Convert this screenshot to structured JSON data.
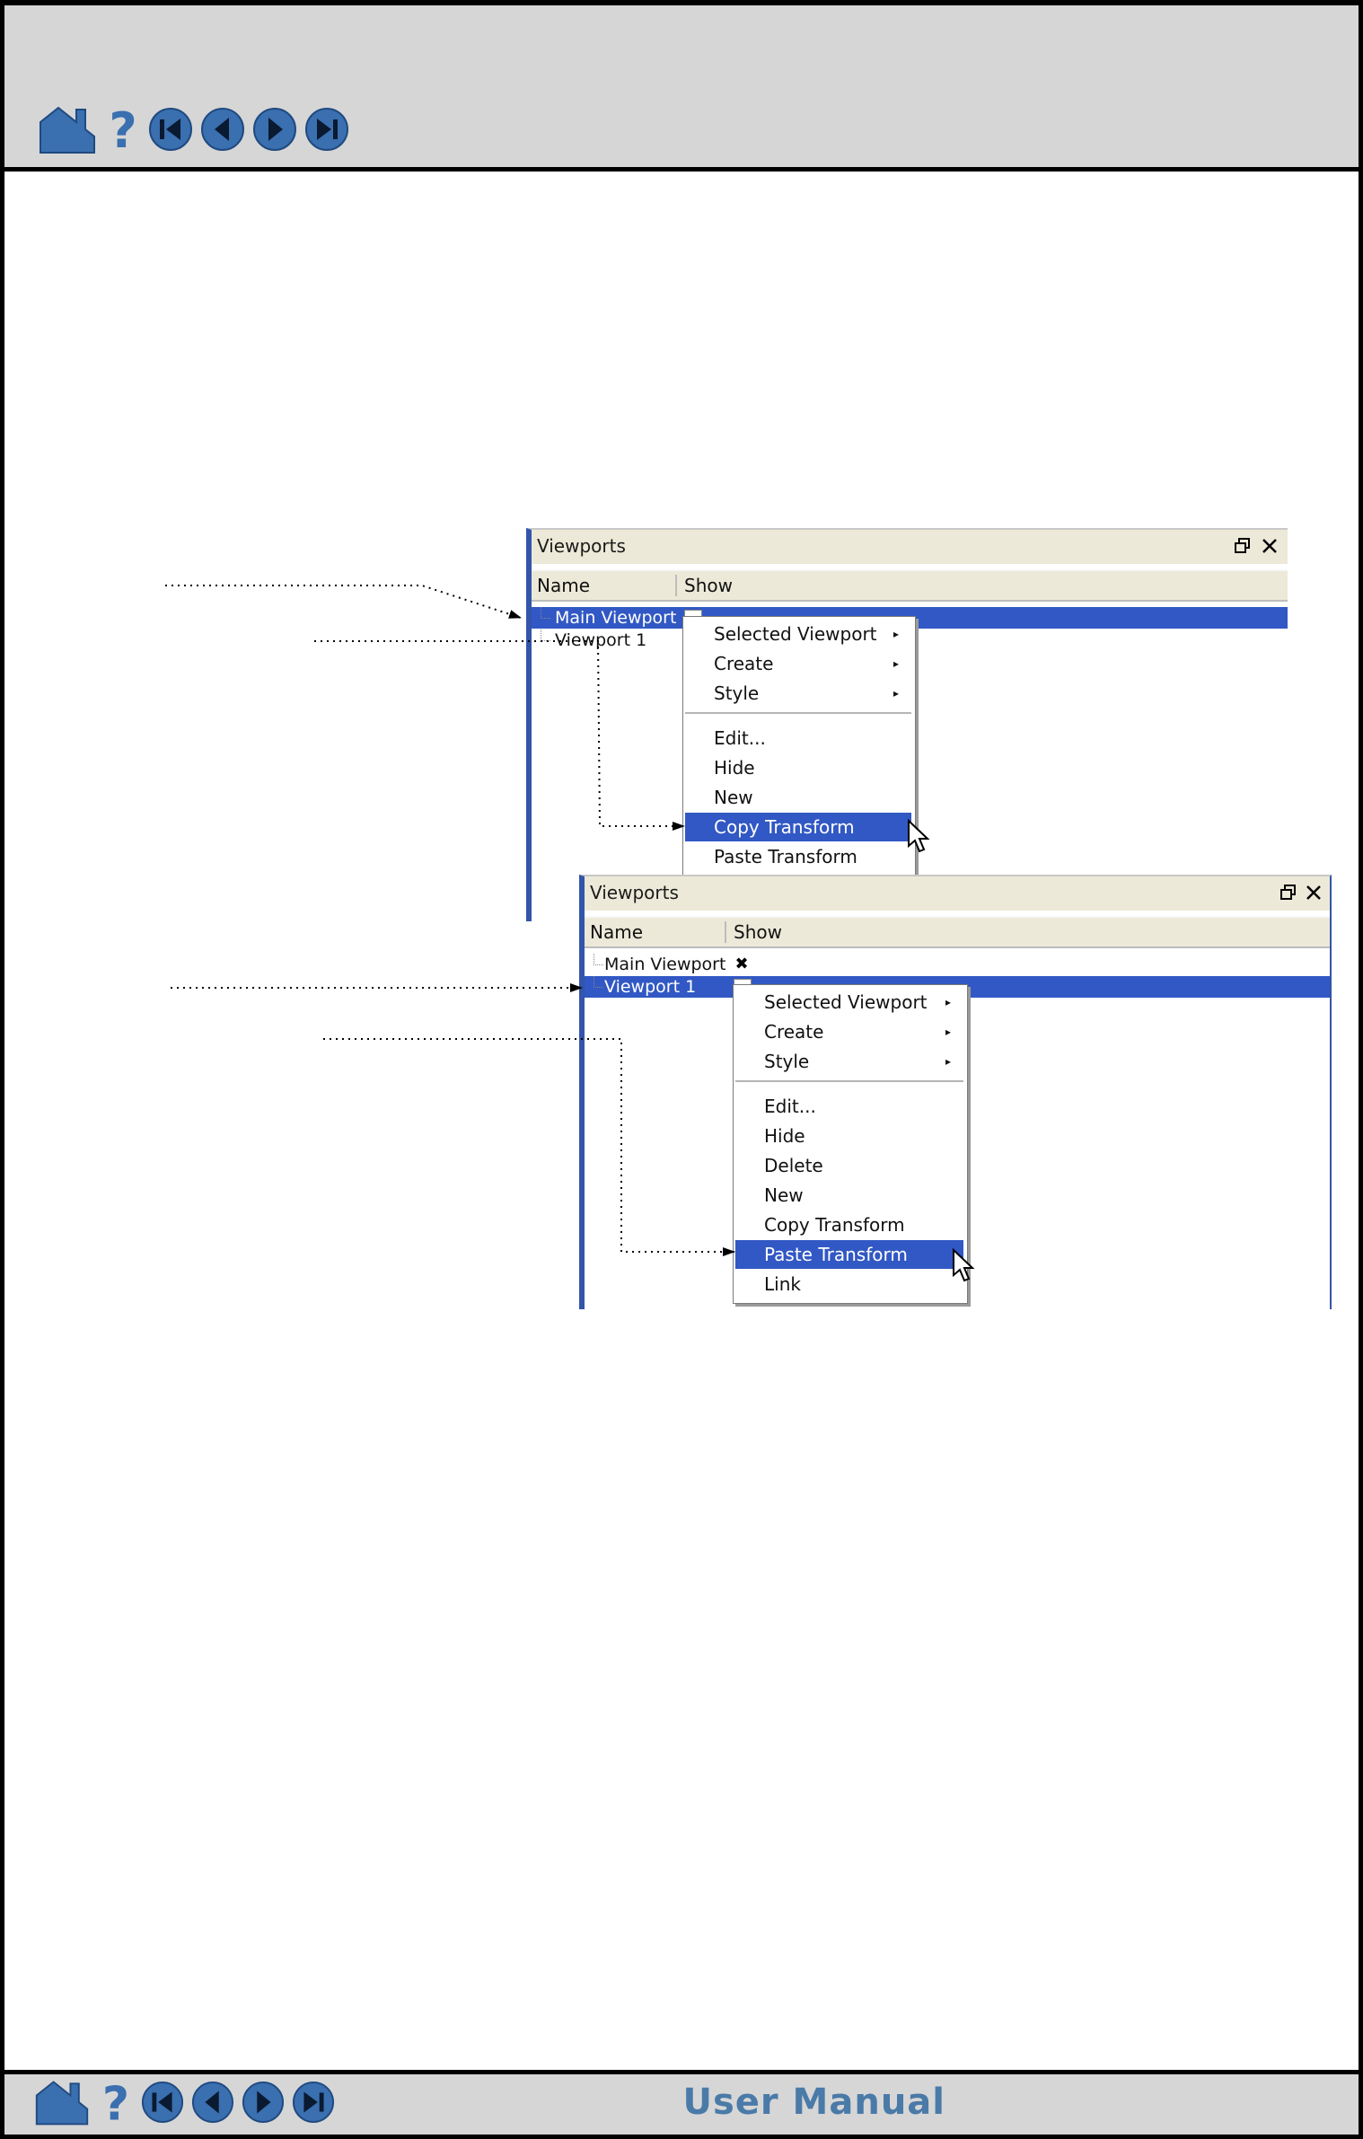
{
  "header": {
    "icons": [
      "home-icon",
      "help-icon",
      "first-page-icon",
      "previous-page-icon",
      "next-page-icon",
      "last-page-icon"
    ]
  },
  "footer": {
    "title": "User Manual"
  },
  "colors": {
    "accent": "#3158c4",
    "icon_blue": "#3a6fb0",
    "bar_gray": "#d6d6d6"
  },
  "panel_top": {
    "title": "Viewports",
    "columns": {
      "name": "Name",
      "show": "Show"
    },
    "rows": [
      {
        "label": "Main Viewport",
        "selected": true
      },
      {
        "label": "Viewport 1",
        "selected": false
      }
    ],
    "menu": {
      "group1": [
        {
          "label": "Selected Viewport",
          "submenu": true
        },
        {
          "label": "Create",
          "submenu": true
        },
        {
          "label": "Style",
          "submenu": true
        }
      ],
      "group2": [
        {
          "label": "Edit..."
        },
        {
          "label": "Hide"
        },
        {
          "label": "New"
        },
        {
          "label": "Copy Transform",
          "highlighted": true
        },
        {
          "label": "Paste Transform"
        }
      ]
    }
  },
  "panel_bottom": {
    "title": "Viewports",
    "columns": {
      "name": "Name",
      "show": "Show"
    },
    "rows": [
      {
        "label": "Main Viewport",
        "selected": false,
        "show_mark": "✖"
      },
      {
        "label": "Viewport 1",
        "selected": true
      }
    ],
    "menu": {
      "group1": [
        {
          "label": "Selected Viewport",
          "submenu": true
        },
        {
          "label": "Create",
          "submenu": true
        },
        {
          "label": "Style",
          "submenu": true
        }
      ],
      "group2": [
        {
          "label": "Edit..."
        },
        {
          "label": "Hide"
        },
        {
          "label": "Delete"
        },
        {
          "label": "New"
        },
        {
          "label": "Copy Transform"
        },
        {
          "label": "Paste Transform",
          "highlighted": true
        },
        {
          "label": "Link"
        }
      ]
    }
  }
}
